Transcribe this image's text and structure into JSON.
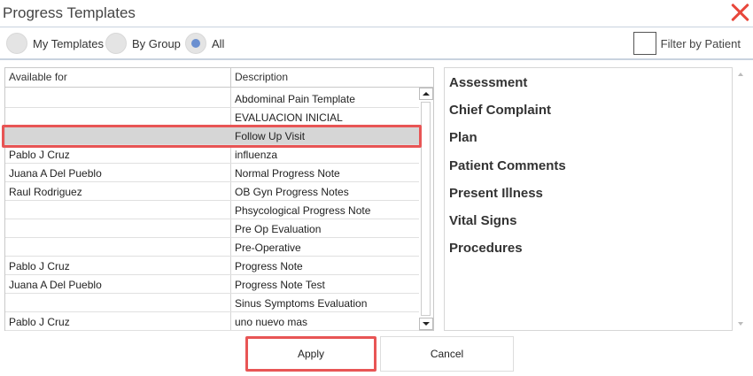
{
  "window": {
    "title": "Progress Templates",
    "close_color": "#e8473b"
  },
  "filters": {
    "radios": [
      {
        "label": "My Templates",
        "checked": false
      },
      {
        "label": "By Group",
        "checked": false
      },
      {
        "label": "All",
        "checked": true
      }
    ],
    "filter_by_patient_label": "Filter by Patient",
    "filter_by_patient_checked": false
  },
  "table": {
    "columns": [
      "Available for",
      "Description"
    ],
    "rows": [
      {
        "available_for": "",
        "description": "Abdominal Pain Template"
      },
      {
        "available_for": "",
        "description": "EVALUACION INICIAL"
      },
      {
        "available_for": "",
        "description": "Follow Up Visit",
        "selected": true
      },
      {
        "available_for": "Pablo J Cruz",
        "description": "influenza"
      },
      {
        "available_for": "Juana A Del Pueblo",
        "description": "Normal Progress Note"
      },
      {
        "available_for": "Raul Rodriguez",
        "description": "OB Gyn Progress Notes"
      },
      {
        "available_for": "",
        "description": "Phsycological Progress Note"
      },
      {
        "available_for": "",
        "description": "Pre Op Evaluation"
      },
      {
        "available_for": "",
        "description": "Pre-Operative"
      },
      {
        "available_for": "Pablo J Cruz",
        "description": "Progress Note"
      },
      {
        "available_for": "Juana A Del Pueblo",
        "description": "Progress Note Test"
      },
      {
        "available_for": "",
        "description": "Sinus Symptoms Evaluation"
      },
      {
        "available_for": "Pablo J Cruz",
        "description": "uno nuevo mas"
      }
    ]
  },
  "sections": [
    "Assessment",
    "Chief Complaint",
    "Plan",
    "Patient Comments",
    "Present Illness",
    "Vital Signs",
    "Procedures"
  ],
  "buttons": {
    "apply": "Apply",
    "cancel": "Cancel"
  },
  "colors": {
    "highlight": "#e85555",
    "radio_checked": "#6a8fd0",
    "selected_row": "#d6d6d6"
  }
}
